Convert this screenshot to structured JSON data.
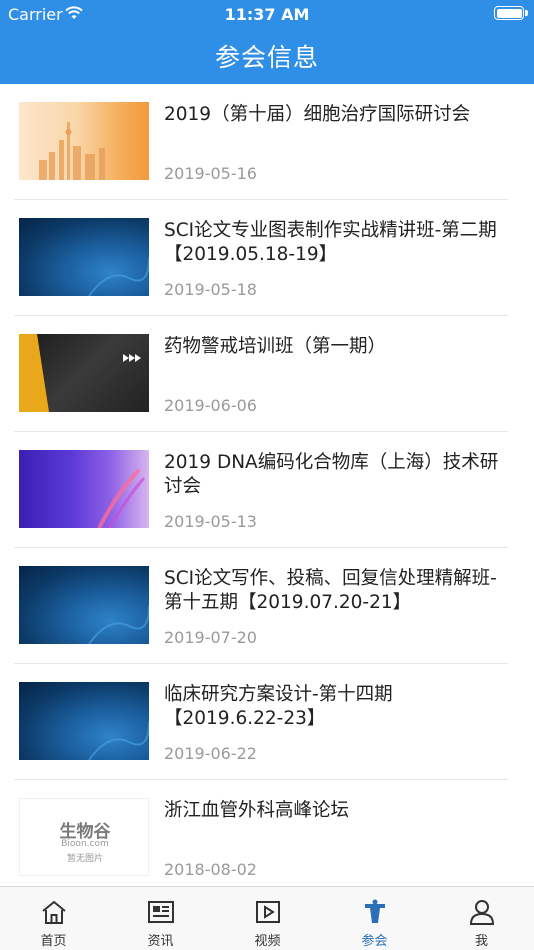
{
  "status_bar": {
    "carrier": "Carrier",
    "time": "11:37 AM"
  },
  "header": {
    "title": "参会信息"
  },
  "items": [
    {
      "title": "2019（第十届）细胞治疗国际研讨会",
      "date": "2019-05-16",
      "thumb": "city-banner"
    },
    {
      "title": "SCI论文专业图表制作实战精讲班-第二期【2019.05.18-19】",
      "date": "2019-05-18",
      "thumb": "blue-dna-banner"
    },
    {
      "title": "药物警戒培训班（第一期）",
      "date": "2019-06-06",
      "thumb": "dark-banner"
    },
    {
      "title": "2019 DNA编码化合物库（上海）技术研讨会",
      "date": "2019-05-13",
      "thumb": "purple-dna-banner"
    },
    {
      "title": "SCI论文写作、投稿、回复信处理精解班-第十五期【2019.07.20-21】",
      "date": "2019-07-20",
      "thumb": "blue-dna-banner"
    },
    {
      "title": "临床研究方案设计-第十四期【2019.6.22-23】",
      "date": "2019-06-22",
      "thumb": "blue-dna-banner"
    },
    {
      "title": "浙江血管外科高峰论坛",
      "date": "2018-08-02",
      "thumb": "placeholder-logo"
    }
  ],
  "placeholder": {
    "brand": "生物谷",
    "domain": "Bioon.com",
    "caption": "暂无图片"
  },
  "tabbar": {
    "tabs": [
      {
        "label": "首页",
        "icon": "home-icon"
      },
      {
        "label": "资讯",
        "icon": "news-icon"
      },
      {
        "label": "视频",
        "icon": "video-icon"
      },
      {
        "label": "参会",
        "icon": "conference-icon",
        "active": true
      },
      {
        "label": "我",
        "icon": "profile-icon"
      }
    ]
  },
  "colors": {
    "header": "#2f8fe6",
    "active_tab": "#2a6fb7",
    "date_text": "#9a9a9a"
  }
}
